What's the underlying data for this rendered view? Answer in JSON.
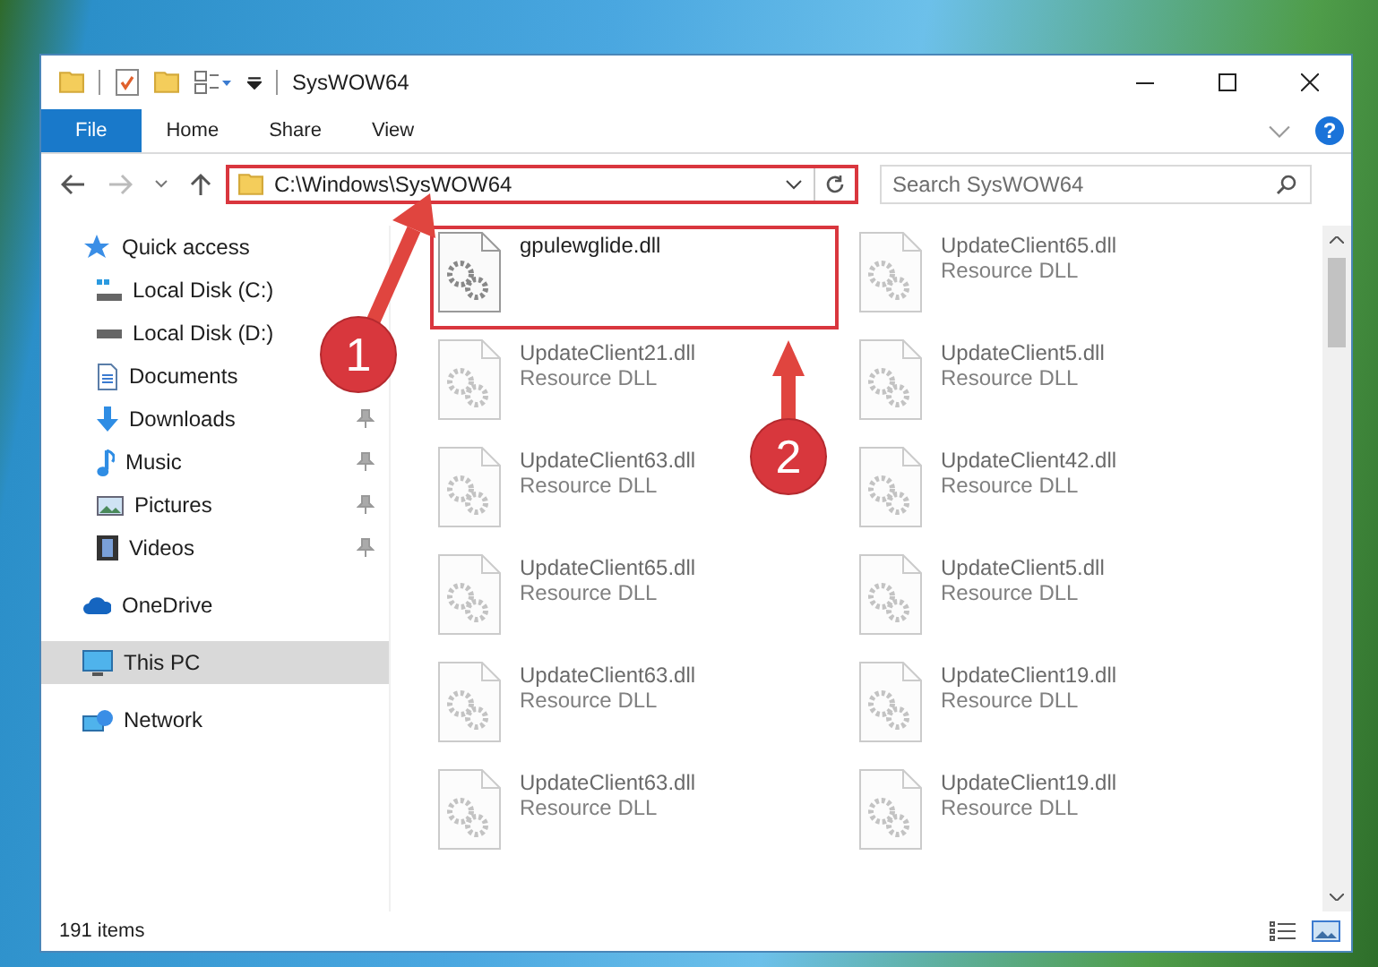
{
  "window": {
    "title": "SysWOW64"
  },
  "ribbon_tabs": [
    {
      "label": "File",
      "selected": true
    },
    {
      "label": "Home",
      "selected": false
    },
    {
      "label": "Share",
      "selected": false
    },
    {
      "label": "View",
      "selected": false
    }
  ],
  "help": {
    "label": "?"
  },
  "address_bar": {
    "path": "C:\\Windows\\SysWOW64",
    "highlighted": true
  },
  "search": {
    "placeholder": "Search SysWOW64"
  },
  "sidebar": {
    "items": [
      {
        "label": "Quick access",
        "kind": "star",
        "indent": false,
        "pinned": false,
        "selected": false
      },
      {
        "label": "Local Disk (C:)",
        "kind": "system-drive",
        "indent": true,
        "pinned": false,
        "selected": false
      },
      {
        "label": "Local Disk (D:)",
        "kind": "drive",
        "indent": true,
        "pinned": false,
        "selected": false
      },
      {
        "label": "Documents",
        "kind": "document",
        "indent": true,
        "pinned": false,
        "selected": false
      },
      {
        "label": "Downloads",
        "kind": "download",
        "indent": true,
        "pinned": true,
        "selected": false
      },
      {
        "label": "Music",
        "kind": "music",
        "indent": true,
        "pinned": true,
        "selected": false
      },
      {
        "label": "Pictures",
        "kind": "picture",
        "indent": true,
        "pinned": true,
        "selected": false
      },
      {
        "label": "Videos",
        "kind": "video",
        "indent": true,
        "pinned": true,
        "selected": false
      },
      {
        "label": "OneDrive",
        "kind": "cloud",
        "indent": false,
        "pinned": false,
        "selected": false
      },
      {
        "label": "This PC",
        "kind": "computer",
        "indent": false,
        "pinned": false,
        "selected": true
      },
      {
        "label": "Network",
        "kind": "network",
        "indent": false,
        "pinned": false,
        "selected": false
      }
    ]
  },
  "files": [
    {
      "name": "gpulewglide.dll",
      "blurred": false,
      "highlighted": true
    },
    {
      "name": "UpdateClient65.dll",
      "type": "Resource DLL",
      "blurred": true,
      "highlighted": false
    },
    {
      "name": "UpdateClient21.dll",
      "type": "Resource DLL",
      "blurred": true,
      "highlighted": false
    },
    {
      "name": "UpdateClient5.dll",
      "type": "Resource DLL",
      "blurred": true,
      "highlighted": false
    },
    {
      "name": "UpdateClient63.dll",
      "type": "Resource DLL",
      "blurred": true,
      "highlighted": false
    },
    {
      "name": "UpdateClient42.dll",
      "type": "Resource DLL",
      "blurred": true,
      "highlighted": false
    },
    {
      "name": "UpdateClient65.dll",
      "type": "Resource DLL",
      "blurred": true,
      "highlighted": false
    },
    {
      "name": "UpdateClient5.dll",
      "type": "Resource DLL",
      "blurred": true,
      "highlighted": false
    },
    {
      "name": "UpdateClient63.dll",
      "type": "Resource DLL",
      "blurred": true,
      "highlighted": false
    },
    {
      "name": "UpdateClient19.dll",
      "type": "Resource DLL",
      "blurred": true,
      "highlighted": false
    },
    {
      "name": "UpdateClient63.dll",
      "type": "Resource DLL",
      "blurred": true,
      "highlighted": false
    },
    {
      "name": "UpdateClient19.dll",
      "type": "Resource DLL",
      "blurred": true,
      "highlighted": false
    }
  ],
  "status_bar": {
    "item_count": "191 items"
  },
  "annotations": [
    {
      "number": "1"
    },
    {
      "number": "2"
    }
  ]
}
